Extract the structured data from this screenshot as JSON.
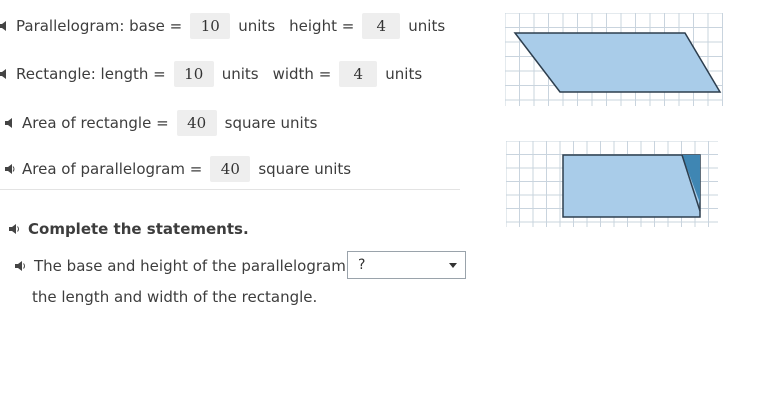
{
  "parallelogram_row": {
    "prefix": "Parallelogram: base =",
    "base_value": "10",
    "units1": "units",
    "height_label": "height =",
    "height_value": "4",
    "units2": "units"
  },
  "rectangle_row": {
    "prefix": "Rectangle: length =",
    "length_value": "10",
    "units1": "units",
    "width_label": "width =",
    "width_value": "4",
    "units2": "units"
  },
  "rect_area_row": {
    "prefix": "Area of rectangle =",
    "value": "40",
    "units": "square units"
  },
  "para_area_row": {
    "prefix": "Area of parallelogram =",
    "value": "40",
    "units": "square units"
  },
  "instruction": "Complete the statements.",
  "statement": {
    "part1": "The base and height of the parallelogram are",
    "dropdown_value": "?",
    "part2": "the length and width of the rectangle."
  },
  "colors": {
    "shape_fill": "#a9cce9",
    "shape_stroke": "#2d3e4e",
    "dark_triangle": "#3f86b3",
    "grid_line": "#c9d4de"
  },
  "icons": [
    "speaker-icon"
  ]
}
